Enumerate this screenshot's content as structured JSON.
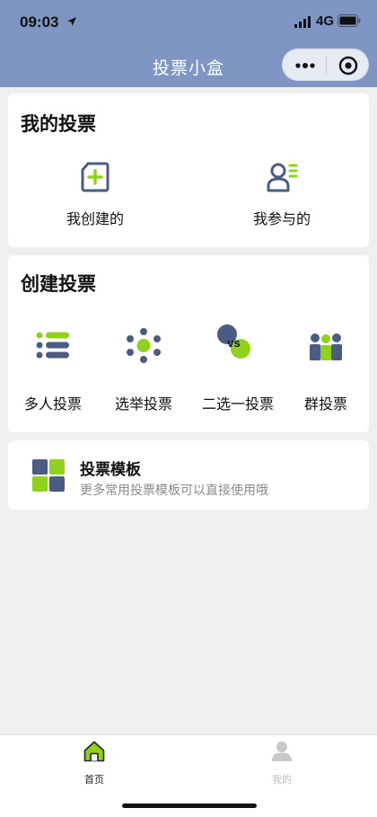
{
  "status_bar": {
    "time": "09:03",
    "network": "4G"
  },
  "nav": {
    "title": "投票小盒"
  },
  "my_votes": {
    "title": "我的投票",
    "items": [
      {
        "label": "我创建的",
        "icon": "create-doc-icon"
      },
      {
        "label": "我参与的",
        "icon": "participant-icon"
      }
    ]
  },
  "create_vote": {
    "title": "创建投票",
    "items": [
      {
        "label": "多人投票",
        "icon": "list-icon"
      },
      {
        "label": "选举投票",
        "icon": "election-dots-icon"
      },
      {
        "label": "二选一投票",
        "icon": "vs-icon",
        "badge": "vs"
      },
      {
        "label": "群投票",
        "icon": "group-icon"
      }
    ]
  },
  "template": {
    "title": "投票模板",
    "subtitle": "更多常用投票模板可以直接使用哦",
    "icon": "template-grid-icon"
  },
  "tabbar": {
    "items": [
      {
        "label": "首页",
        "icon": "home-icon",
        "active": true
      },
      {
        "label": "我的",
        "icon": "profile-icon",
        "active": false
      }
    ]
  },
  "colors": {
    "header": "#7f96c4",
    "accent_green": "#8fd11b",
    "icon_blue": "#4a5c82",
    "background": "#efefef"
  }
}
